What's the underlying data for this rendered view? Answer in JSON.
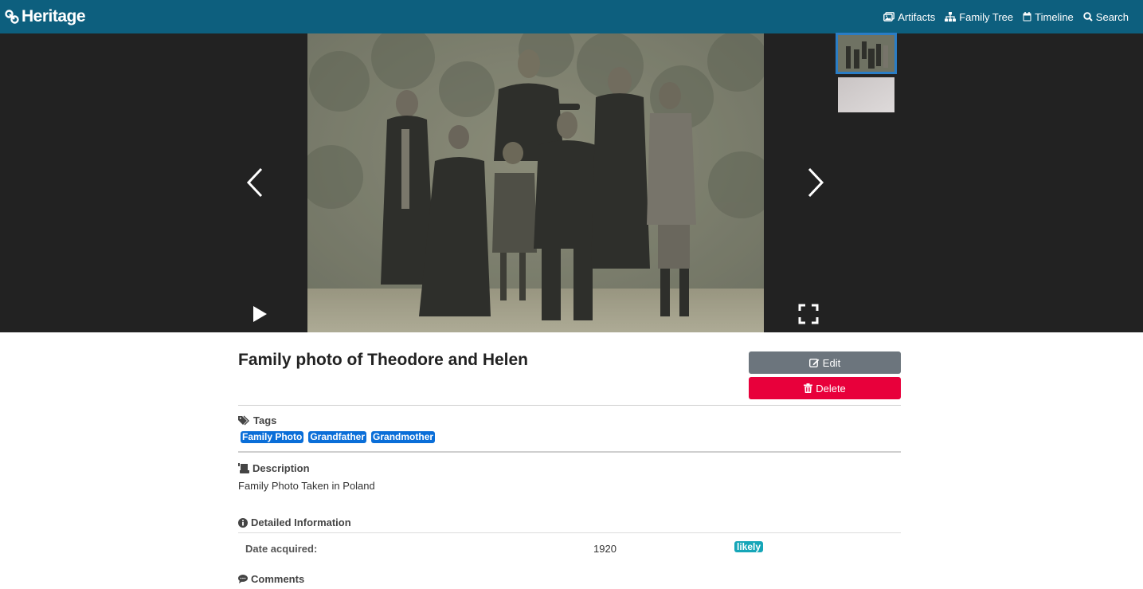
{
  "nav": {
    "brand": "Heritage",
    "links": [
      {
        "label": "Artifacts",
        "icon": "images-icon"
      },
      {
        "label": "Family Tree",
        "icon": "sitemap-icon"
      },
      {
        "label": "Timeline",
        "icon": "calendar-icon"
      },
      {
        "label": "Search",
        "icon": "search-icon"
      }
    ]
  },
  "viewer": {
    "photo_alt": "Family photo of Theodore and Helen",
    "thumbnail_count": 2,
    "selected_thumbnail": 1
  },
  "artifact": {
    "title": "Family photo of Theodore and Helen",
    "edit_label": "Edit",
    "delete_label": "Delete"
  },
  "tags": {
    "heading": "Tags",
    "items": [
      "Family Photo",
      "Grandfather",
      "Grandmother"
    ]
  },
  "description": {
    "heading": "Description",
    "text": "Family Photo Taken in Poland"
  },
  "details": {
    "heading": "Detailed Information",
    "rows": [
      {
        "label": "Date acquired:",
        "value": "1920",
        "badge": "likely"
      }
    ]
  },
  "comments": {
    "heading": "Comments"
  },
  "colors": {
    "navbar": "#0d5f7e",
    "viewer_bg": "#222222",
    "edit_button": "#6c757d",
    "delete_button": "#e8003b",
    "tag": "#0a6ed8",
    "badge": "#16a6b8",
    "thumb_selected": "#2a7dc5"
  }
}
